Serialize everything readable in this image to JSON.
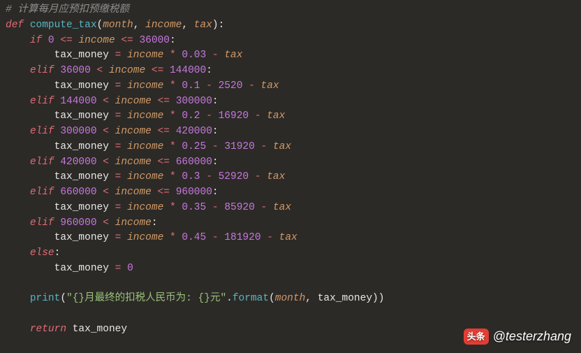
{
  "code": {
    "comment": "# 计算每月应预扣预缴税额",
    "def_kw": "def",
    "func_name": "compute_tax",
    "params": {
      "p1": "month",
      "p2": "income",
      "p3": "tax"
    },
    "brackets": {
      "lbl": [
        0,
        36000
      ]
    },
    "branches": [
      {
        "kw": "if",
        "low": 0,
        "cmp1": "<=",
        "mid": "income",
        "cmp2": "<=",
        "high": 36000,
        "mul": 0.03,
        "deduct": null,
        "minus_tax": true
      },
      {
        "kw": "elif",
        "low": 36000,
        "cmp1": "<",
        "mid": "income",
        "cmp2": "<=",
        "high": 144000,
        "mul": 0.1,
        "deduct": 2520,
        "minus_tax": true
      },
      {
        "kw": "elif",
        "low": 144000,
        "cmp1": "<",
        "mid": "income",
        "cmp2": "<=",
        "high": 300000,
        "mul": 0.2,
        "deduct": 16920,
        "minus_tax": true
      },
      {
        "kw": "elif",
        "low": 300000,
        "cmp1": "<",
        "mid": "income",
        "cmp2": "<=",
        "high": 420000,
        "mul": 0.25,
        "deduct": 31920,
        "minus_tax": true
      },
      {
        "kw": "elif",
        "low": 420000,
        "cmp1": "<",
        "mid": "income",
        "cmp2": "<=",
        "high": 660000,
        "mul": 0.3,
        "deduct": 52920,
        "minus_tax": true
      },
      {
        "kw": "elif",
        "low": 660000,
        "cmp1": "<",
        "mid": "income",
        "cmp2": "<=",
        "high": 960000,
        "mul": 0.35,
        "deduct": 85920,
        "minus_tax": true
      },
      {
        "kw": "elif",
        "low": 960000,
        "cmp1": "<",
        "mid": "income",
        "cmp2": null,
        "high": null,
        "mul": 0.45,
        "deduct": 181920,
        "minus_tax": true
      }
    ],
    "else_kw": "else",
    "else_body_var": "tax_money",
    "else_body_val": 0,
    "lhs_var": "tax_money",
    "mul_op": "*",
    "sub_op": "-",
    "eq_op": "=",
    "print_fn": "print",
    "print_str": "\"{}月最终的扣税人民币为: {}元\"",
    "format_fn": "format",
    "format_arg1": "month",
    "format_arg2": "tax_money",
    "return_kw": "return",
    "return_val": "tax_money",
    "colon": ":",
    "comma": ", ",
    "dot": ".",
    "lparen": "(",
    "rparen": ")"
  },
  "watermark": {
    "badge": "头条",
    "handle": "@testerzhang"
  }
}
